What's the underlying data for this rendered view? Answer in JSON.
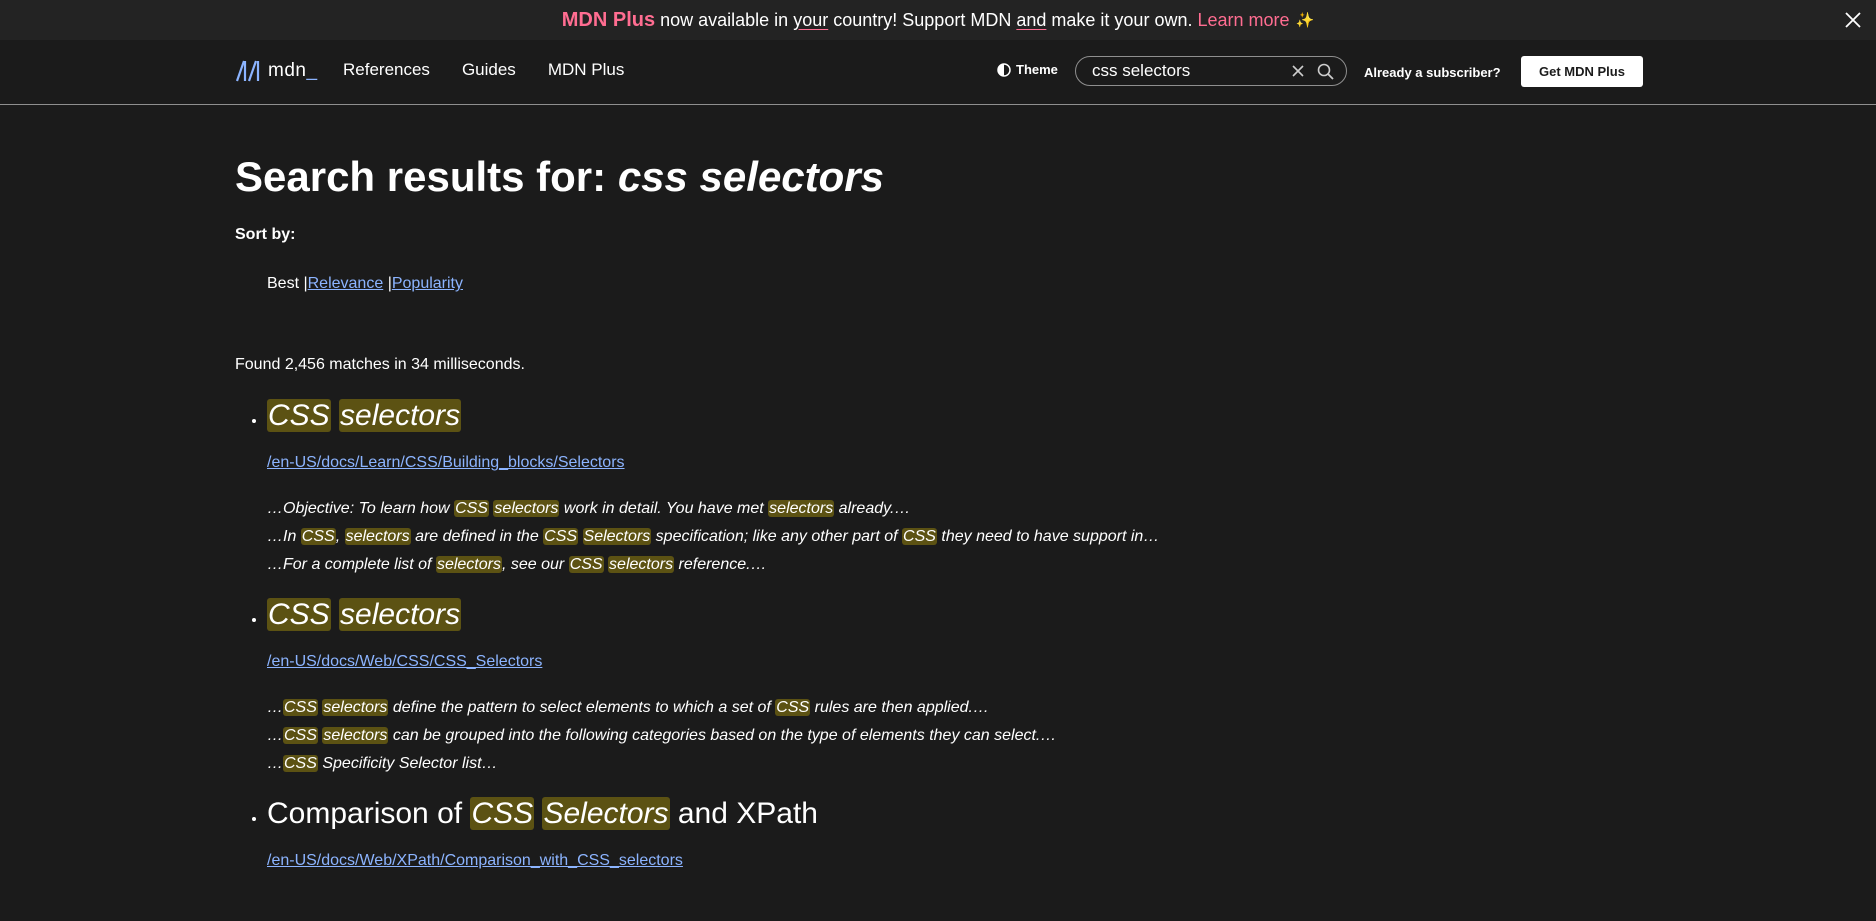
{
  "banner": {
    "brand": "MDN Plus",
    "text_before": "now available in",
    "text_your": "your",
    "text_mid": "country! Support MDN",
    "text_and": "and",
    "text_after": "make it your own.",
    "learn_more": "Learn more",
    "sparkle": "✨",
    "close_icon": "close-icon"
  },
  "header": {
    "logo_text": "mdn",
    "logo_suffix": "_",
    "nav": [
      "References",
      "Guides",
      "MDN Plus"
    ],
    "theme_label": "Theme",
    "search_value": "css selectors",
    "subscriber_text": "Already a subscriber?",
    "get_plus": "Get MDN Plus"
  },
  "main": {
    "title_prefix": "Search results for:",
    "title_query": "css selectors",
    "sort_label": "Sort by:",
    "sort_best": "Best",
    "sort_sep": "|",
    "sort_relevance": "Relevance",
    "sort_popularity": "Popularity",
    "found": "Found 2,456 matches in 34 milliseconds."
  },
  "results": [
    {
      "title": [
        {
          "t": "CSS",
          "h": true
        },
        {
          "t": " "
        },
        {
          "t": "selectors",
          "h": true
        }
      ],
      "url": "/en-US/docs/Learn/CSS/Building_blocks/Selectors",
      "snippets": [
        [
          {
            "t": "…Objective: To learn how "
          },
          {
            "t": "CSS",
            "h": true
          },
          {
            "t": " "
          },
          {
            "t": "selectors",
            "h": true
          },
          {
            "t": " work in detail. You have met "
          },
          {
            "t": "selectors",
            "h": true
          },
          {
            "t": " already.…"
          }
        ],
        [
          {
            "t": "…In "
          },
          {
            "t": "CSS",
            "h": true
          },
          {
            "t": ", "
          },
          {
            "t": "selectors",
            "h": true
          },
          {
            "t": " are defined in the "
          },
          {
            "t": "CSS",
            "h": true
          },
          {
            "t": " "
          },
          {
            "t": "Selectors",
            "h": true
          },
          {
            "t": " specification; like any other part of "
          },
          {
            "t": "CSS",
            "h": true
          },
          {
            "t": " they need to have support in…"
          }
        ],
        [
          {
            "t": "…For a complete list of "
          },
          {
            "t": "selectors",
            "h": true
          },
          {
            "t": ", see our "
          },
          {
            "t": "CSS",
            "h": true
          },
          {
            "t": " "
          },
          {
            "t": "selectors",
            "h": true
          },
          {
            "t": " reference.…"
          }
        ]
      ]
    },
    {
      "title": [
        {
          "t": "CSS",
          "h": true
        },
        {
          "t": " "
        },
        {
          "t": "selectors",
          "h": true
        }
      ],
      "url": "/en-US/docs/Web/CSS/CSS_Selectors",
      "snippets": [
        [
          {
            "t": "…"
          },
          {
            "t": "CSS",
            "h": true
          },
          {
            "t": " "
          },
          {
            "t": "selectors",
            "h": true
          },
          {
            "t": " define the pattern to select elements to which a set of "
          },
          {
            "t": "CSS",
            "h": true
          },
          {
            "t": " rules are then applied.…"
          }
        ],
        [
          {
            "t": "…"
          },
          {
            "t": "CSS",
            "h": true
          },
          {
            "t": " "
          },
          {
            "t": "selectors",
            "h": true
          },
          {
            "t": " can be grouped into the following categories based on the type of elements they can select.…"
          }
        ],
        [
          {
            "t": "…"
          },
          {
            "t": "CSS",
            "h": true
          },
          {
            "t": " Specificity Selector list…"
          }
        ]
      ]
    },
    {
      "title": [
        {
          "t": "Comparison of "
        },
        {
          "t": "CSS",
          "h": true
        },
        {
          "t": " "
        },
        {
          "t": "Selectors",
          "h": true
        },
        {
          "t": " and XPath"
        }
      ],
      "url": "/en-US/docs/Web/XPath/Comparison_with_CSS_selectors",
      "snippets": []
    }
  ],
  "colors": {
    "background": "#1b1b1b",
    "banner_accent": "#ff6d91",
    "link": "#8cb4ff",
    "highlight": "#5c5213"
  }
}
